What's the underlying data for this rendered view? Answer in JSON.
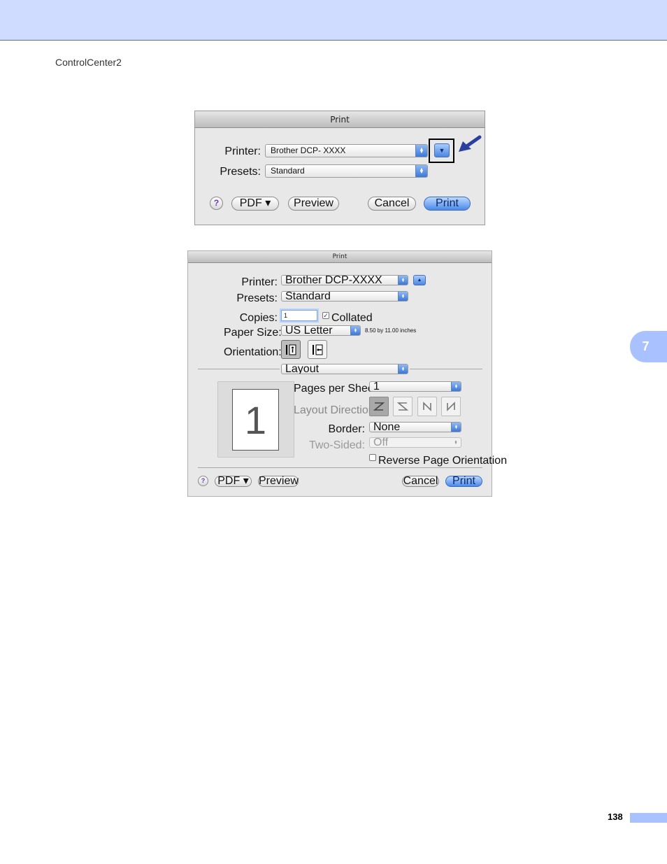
{
  "page": {
    "running_header": "ControlCenter2",
    "chapter_number": "7",
    "page_number": "138"
  },
  "dialog_collapsed": {
    "title": "Print",
    "printer_label": "Printer:",
    "printer_value": "Brother DCP- XXXX",
    "presets_label": "Presets:",
    "presets_value": "Standard",
    "help": "?",
    "pdf_button": "PDF ▾",
    "preview_button": "Preview",
    "cancel_button": "Cancel",
    "print_button": "Print"
  },
  "dialog_expanded": {
    "title": "Print",
    "printer_label": "Printer:",
    "printer_value": "Brother DCP-XXXX",
    "presets_label": "Presets:",
    "presets_value": "Standard",
    "copies_label": "Copies:",
    "copies_value": "1",
    "collated_label": "Collated",
    "collated_checked": true,
    "paper_size_label": "Paper Size:",
    "paper_size_value": "US Letter",
    "paper_size_dims": "8.50 by 11.00 inches",
    "orientation_label": "Orientation:",
    "panel_value": "Layout",
    "preview_page_number": "1",
    "pages_per_sheet_label": "Pages per Sheet:",
    "pages_per_sheet_value": "1",
    "layout_direction_label": "Layout Direction:",
    "border_label": "Border:",
    "border_value": "None",
    "two_sided_label": "Two-Sided:",
    "two_sided_value": "Off",
    "reverse_label": "Reverse Page Orientation",
    "reverse_checked": false,
    "help": "?",
    "pdf_button": "PDF ▾",
    "preview_button": "Preview",
    "cancel_button": "Cancel",
    "print_button": "Print"
  },
  "colors": {
    "header_band": "#cfdcff",
    "chapter_tab": "#a9c2ff",
    "default_button": "#4a8ae8",
    "callout_arrow": "#2a3f9e"
  }
}
